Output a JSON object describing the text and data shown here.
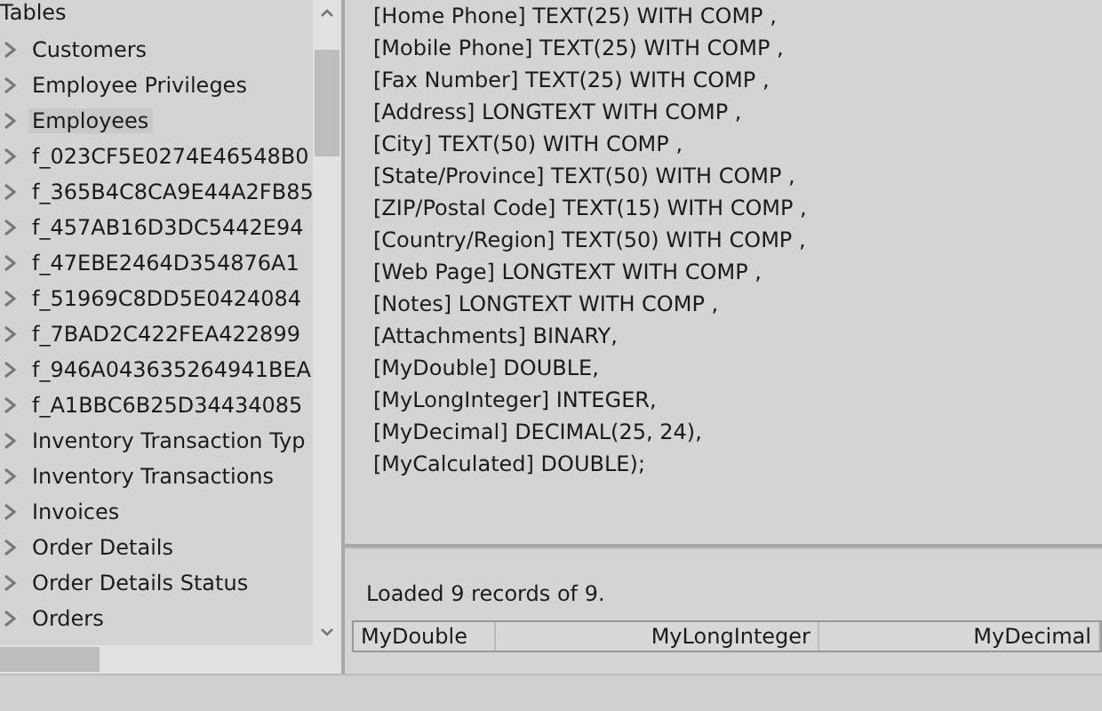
{
  "tree": {
    "root": "Tables",
    "items": [
      {
        "label": "Customers",
        "selected": false
      },
      {
        "label": "Employee Privileges",
        "selected": false
      },
      {
        "label": "Employees",
        "selected": true
      },
      {
        "label": "f_023CF5E0274E46548B0",
        "selected": false
      },
      {
        "label": "f_365B4C8CA9E44A2FB85",
        "selected": false
      },
      {
        "label": "f_457AB16D3DC5442E94",
        "selected": false
      },
      {
        "label": "f_47EBE2464D354876A1",
        "selected": false
      },
      {
        "label": "f_51969C8DD5E0424084",
        "selected": false
      },
      {
        "label": "f_7BAD2C422FEA422899",
        "selected": false
      },
      {
        "label": "f_946A043635264941BEA",
        "selected": false
      },
      {
        "label": "f_A1BBC6B25D34434085",
        "selected": false
      },
      {
        "label": "Inventory Transaction Typ",
        "selected": false
      },
      {
        "label": "Inventory Transactions",
        "selected": false
      },
      {
        "label": "Invoices",
        "selected": false
      },
      {
        "label": "Order Details",
        "selected": false
      },
      {
        "label": "Order Details Status",
        "selected": false
      },
      {
        "label": "Orders",
        "selected": false
      }
    ]
  },
  "sql_lines": [
    "[Home Phone] TEXT(25) WITH COMP ,",
    "[Mobile Phone] TEXT(25) WITH COMP ,",
    "[Fax Number] TEXT(25) WITH COMP ,",
    "[Address] LONGTEXT WITH COMP ,",
    "[City] TEXT(50) WITH COMP ,",
    "[State/Province] TEXT(50) WITH COMP ,",
    "[ZIP/Postal Code] TEXT(15) WITH COMP ,",
    "[Country/Region] TEXT(50) WITH COMP ,",
    "[Web Page] LONGTEXT WITH COMP ,",
    "[Notes] LONGTEXT WITH COMP ,",
    "[Attachments] BINARY,",
    "[MyDouble] DOUBLE,",
    "[MyLongInteger] INTEGER,",
    "[MyDecimal] DECIMAL(25, 24),",
    "[MyCalculated] DOUBLE);"
  ],
  "status": "Loaded 9 records of 9.",
  "table": {
    "columns": [
      "MyDouble",
      "MyLongInteger",
      "MyDecimal"
    ]
  }
}
